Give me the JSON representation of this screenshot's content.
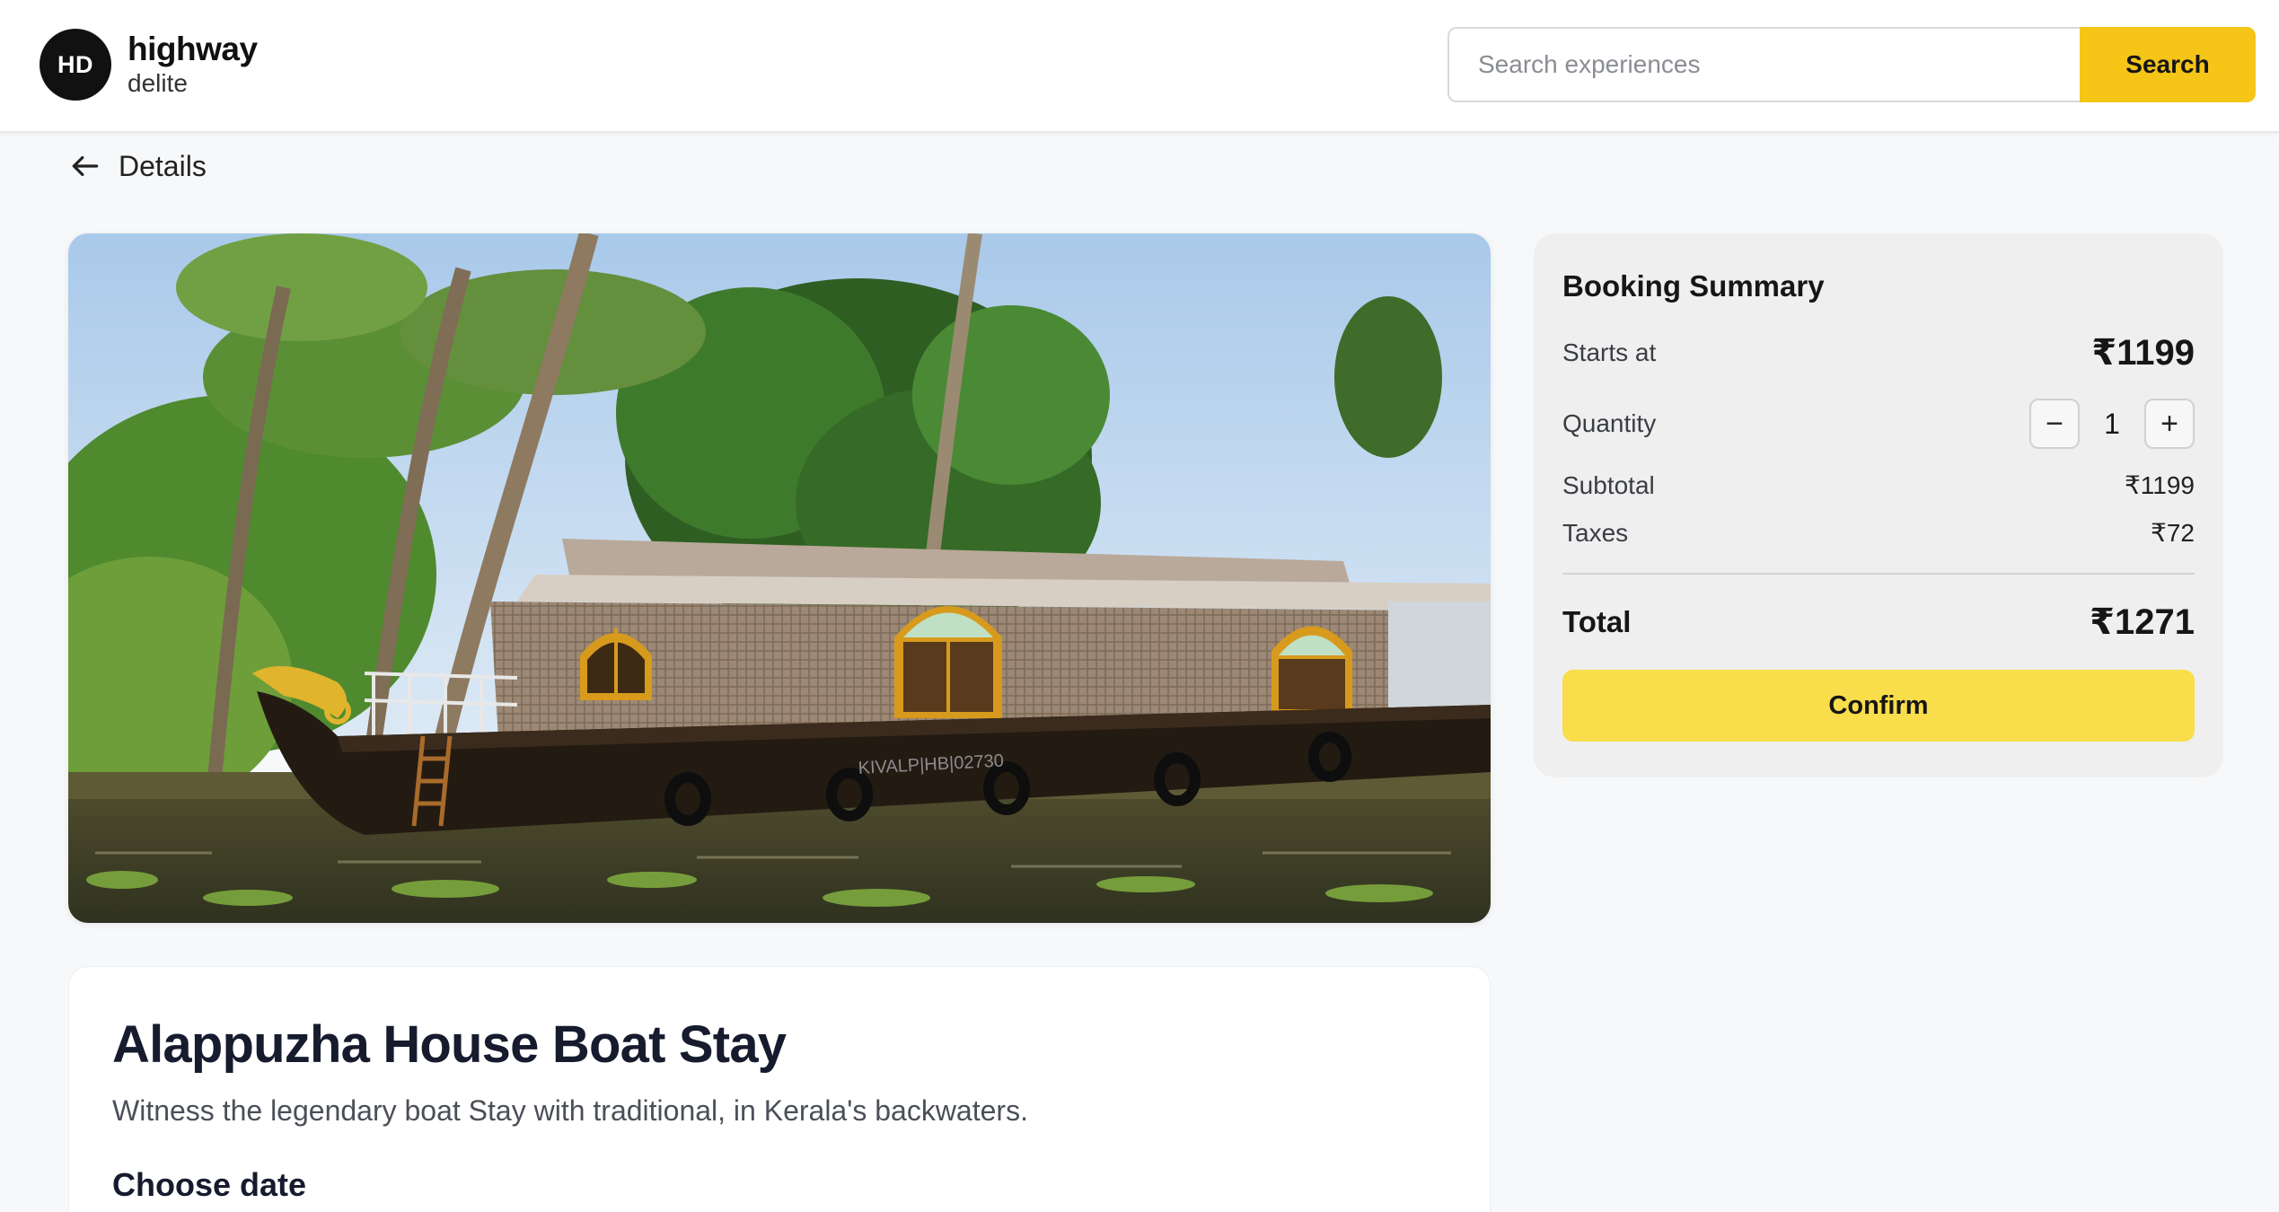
{
  "header": {
    "logo_initials": "HD",
    "logo_line1": "highway",
    "logo_line2": "delite",
    "search_placeholder": "Search experiences",
    "search_button": "Search"
  },
  "nav": {
    "back_label": "Details"
  },
  "experience": {
    "title": "Alappuzha House Boat Stay",
    "description": "Witness the legendary boat Stay with traditional, in Kerala's backwaters.",
    "choose_date_label": "Choose date",
    "boat_registration": "KIVALP|HB|02730"
  },
  "booking": {
    "heading": "Booking Summary",
    "starts_at_label": "Starts at",
    "starts_at_value": "₹1199",
    "quantity_label": "Quantity",
    "quantity_value": "1",
    "minus_symbol": "−",
    "plus_symbol": "+",
    "subtotal_label": "Subtotal",
    "subtotal_value": "₹1199",
    "taxes_label": "Taxes",
    "taxes_value": "₹72",
    "total_label": "Total",
    "total_value": "₹1271",
    "confirm_label": "Confirm"
  },
  "colors": {
    "accent": "#f5c518",
    "confirm": "#f9dd4a",
    "logo_bg": "#111111",
    "page_bg": "#f7f8fa",
    "summary_bg": "#efefef"
  },
  "icons": {
    "back": "arrow-left-icon"
  }
}
